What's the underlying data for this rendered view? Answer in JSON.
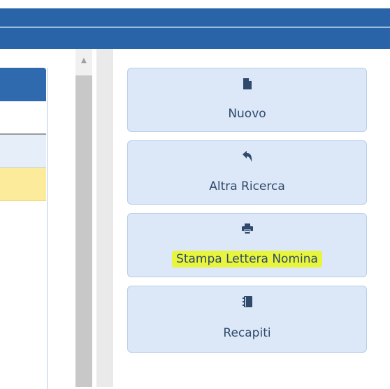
{
  "toolbar": {
    "buttons": [
      {
        "label": "Nuovo",
        "icon": "new-file-icon"
      },
      {
        "label": "Altra Ricerca",
        "icon": "reply-arrow-icon"
      },
      {
        "label": "Stampa Lettera Nomina",
        "icon": "print-icon",
        "highlighted": true
      },
      {
        "label": "Recapiti",
        "icon": "address-book-icon"
      }
    ]
  },
  "colors": {
    "header_blue": "#2a64a8",
    "button_bg": "#dce8f8",
    "button_border": "#b7cdea",
    "selected_row": "#fbeb9a",
    "highlight": "#e8f53c"
  }
}
